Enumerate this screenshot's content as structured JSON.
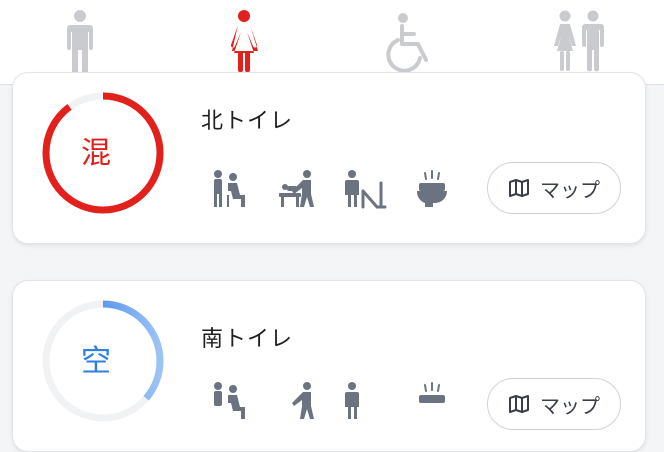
{
  "tabs": [
    {
      "icon": "man-icon",
      "color": "#c9cbcf"
    },
    {
      "icon": "woman-icon",
      "color": "#e3211c",
      "selected": true
    },
    {
      "icon": "wheelchair-icon",
      "color": "#c9cbcf"
    },
    {
      "icon": "family-restroom-icon",
      "color": "#c9cbcf"
    }
  ],
  "colors": {
    "accent": "#1f6fe5",
    "busy": "#e3211c",
    "empty": "#2f7de6",
    "icon": "#6b7280"
  },
  "toilets": [
    {
      "name": "北トイレ",
      "status": "混",
      "map_label": "マップ"
    },
    {
      "name": "南トイレ",
      "status": "空",
      "map_label": "マップ"
    }
  ]
}
